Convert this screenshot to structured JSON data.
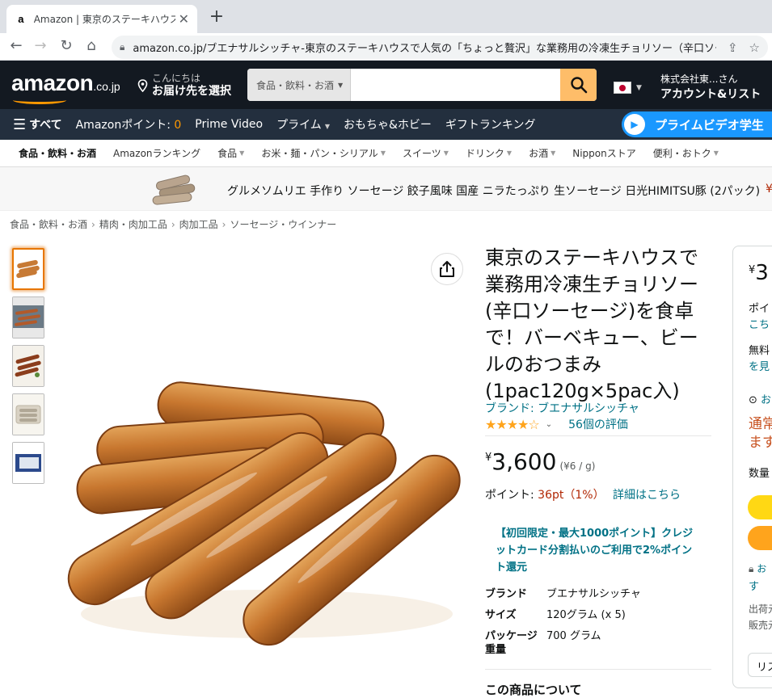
{
  "browser": {
    "tab_title": "Amazon | 東京のステーキハウスで業務",
    "tab_favicon": "a",
    "url": "amazon.co.jp/ブエナサルシッチャ-東京のステーキハウスで人気の「ちょっと贅沢」な業務用の冷凍生チョリソー（辛口ソーセージ）..."
  },
  "header": {
    "logo_text": "amazon",
    "logo_suffix": ".co.jp",
    "deliver_line1": "こんにちは",
    "deliver_line2": "お届け先を選択",
    "search_category": "食品・飲料・お酒",
    "search_placeholder": "",
    "account_line1": "株式会社東...さん",
    "account_line2": "アカウント&リスト"
  },
  "nav": {
    "all_label": "すべて",
    "points_label": "Amazonポイント:",
    "points_value": "0",
    "items": [
      "Prime Video",
      "プライム",
      "おもちゃ&ホビー",
      "ギフトランキング"
    ],
    "prime_banner": "プライムビデオ学生"
  },
  "subnav": {
    "items": [
      "食品・飲料・お酒",
      "Amazonランキング",
      "食品",
      "お米・麺・パン・シリアル",
      "スイーツ",
      "ドリンク",
      "お酒",
      "Nipponストア",
      "便利・おトク"
    ]
  },
  "promo": {
    "text": "グルメソムリエ 手作り ソーセージ 餃子風味 国産 ニラたっぷり 生ソーセージ 日光HIMITSU豚 (2パック)",
    "price_prefix": "¥"
  },
  "breadcrumbs": [
    "食品・飲料・お酒",
    "精肉・肉加工品",
    "肉加工品",
    "ソーセージ・ウインナー"
  ],
  "product": {
    "title": "東京のステーキハウスで業務用冷凍生チョリソー(辛口ソーセージ)を食卓で！バーベキュー、ビールのおつまみ(1pac120g×5pac入)",
    "brand_link": "ブランド: ブエナサルシッチャ",
    "stars": "★★★★☆",
    "rating": 4.1,
    "rating_caret": "⌄",
    "review_count": "56個の評価",
    "price_symbol": "¥",
    "price": "3,600",
    "unit_price": "(¥6 / g)",
    "points_label": "ポイント:",
    "points_value": "36pt（1%）",
    "points_link": "詳細はこちら",
    "promo_text": "【初回限定・最大1000ポイント】クレジットカード分割払いのご利用で2%ポイント還元",
    "specs": [
      {
        "key": "ブランド",
        "value": "ブエナサルシッチャ"
      },
      {
        "key": "サイズ",
        "value": "120グラム (x 5)"
      },
      {
        "key": "パッケージ重量",
        "value": "700 グラム"
      }
    ],
    "about_heading": "この商品について"
  },
  "buybox": {
    "price_symbol": "¥",
    "price_partial": "3",
    "line_points": "ポイ",
    "line_link1": "こち",
    "line_free": "無料",
    "line_link2": "を見",
    "line_deliver": "お",
    "line_normal": "通常",
    "line_masu": "ます",
    "qty_label": "数量",
    "secure": "お",
    "secure2": "す",
    "ship_from": "出荷元",
    "sold_by": "販売元",
    "list_button": "リス"
  },
  "colors": {
    "nav_dark": "#131921",
    "nav_secondary": "#232f3e",
    "accent_orange": "#ff9900",
    "search_button": "#febd69",
    "link": "#007185",
    "price_red": "#b12704",
    "prime_blue": "#1a98ff"
  }
}
